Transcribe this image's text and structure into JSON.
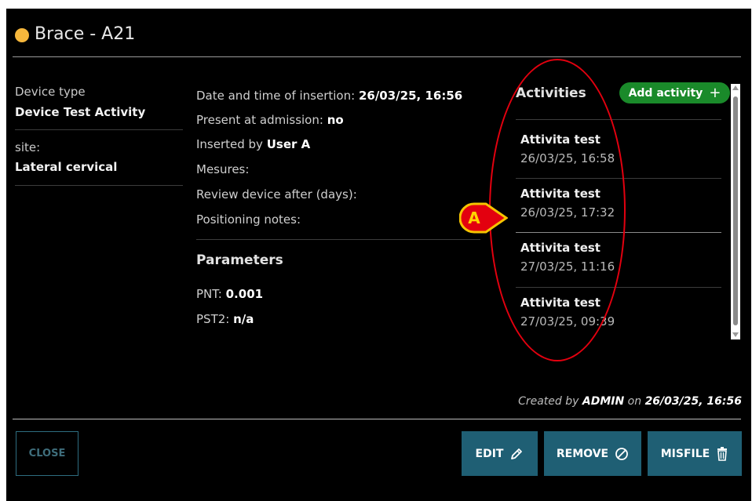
{
  "window": {
    "title": "Brace - A21",
    "status_color": "#f6b73c"
  },
  "left_panel": {
    "device_type_label": "Device type",
    "device_type_value": "Device Test Activity",
    "site_label": "site:",
    "site_value": "Lateral cervical"
  },
  "details": {
    "insertion_label": "Date and time of insertion:",
    "insertion_value": "26/03/25, 16:56",
    "admission_label": "Present at admission:",
    "admission_value": "no",
    "inserted_by_label": "Inserted by",
    "inserted_by_value": "User A",
    "mesures_label": "Mesures:",
    "review_label": "Review device after (days):",
    "positioning_label": "Positioning notes:"
  },
  "parameters": {
    "title": "Parameters",
    "items": [
      {
        "label": "PNT:",
        "value": "0.001"
      },
      {
        "label": "PST2:",
        "value": "n/a"
      }
    ]
  },
  "activities": {
    "title": "Activities",
    "add_label": "Add activity",
    "add_icon": "plus-icon",
    "items": [
      {
        "name": "Attivita test",
        "date": "26/03/25, 16:58"
      },
      {
        "name": "Attivita test",
        "date": "26/03/25, 17:32"
      },
      {
        "name": "Attivita test",
        "date": "27/03/25, 11:16"
      },
      {
        "name": "Attivita test",
        "date": "27/03/25, 09:39"
      }
    ]
  },
  "annotation": {
    "label": "A",
    "color": "#e3000f"
  },
  "footer": {
    "created_prefix": "Created by",
    "created_user": "ADMIN",
    "created_on": "on",
    "created_date": "26/03/25, 16:56"
  },
  "buttons": {
    "close": "CLOSE",
    "edit": "EDIT",
    "remove": "REMOVE",
    "misfile": "MISFILE"
  },
  "colors": {
    "accent_green": "#1a8a2a",
    "button_teal": "#1f5f74",
    "background": "#000000"
  }
}
